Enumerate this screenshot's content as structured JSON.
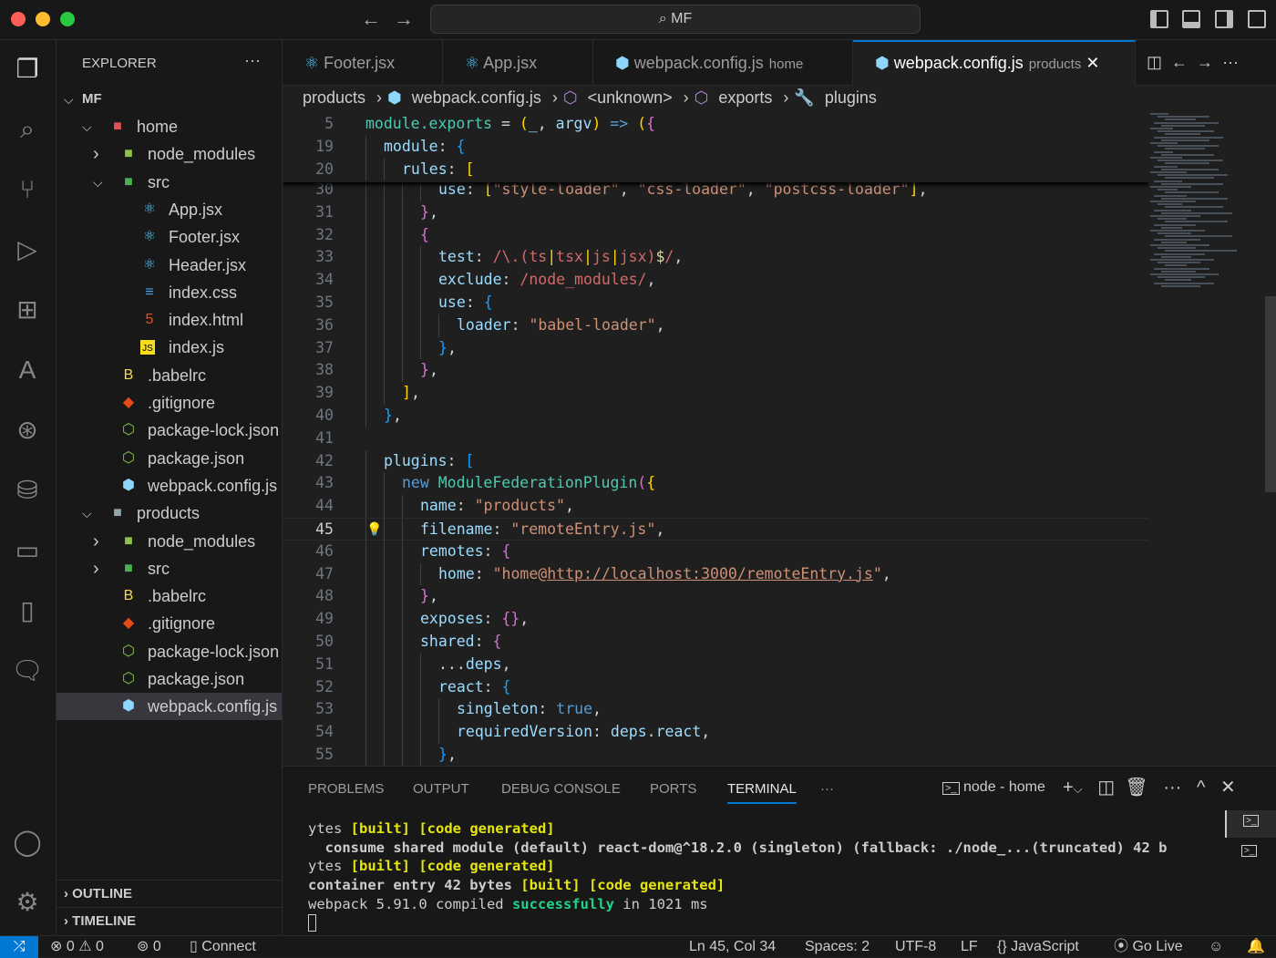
{
  "titlebar": {
    "search": "MF",
    "search_icon": "search-icon"
  },
  "explorer": {
    "title": "EXPLORER",
    "root": "MF",
    "tree": [
      {
        "label": "home",
        "depth": 1,
        "type": "folder-open",
        "icon": "home-folder-icon",
        "color": "#e05252"
      },
      {
        "label": "node_modules",
        "depth": 2,
        "type": "folder",
        "icon": "node-folder-icon",
        "color": "#8bc34a"
      },
      {
        "label": "src",
        "depth": 2,
        "type": "folder-open",
        "icon": "src-folder-icon",
        "color": "#4caf50"
      },
      {
        "label": "App.jsx",
        "depth": 3,
        "type": "file",
        "icon": "react-icon",
        "color": "#4fc3f7"
      },
      {
        "label": "Footer.jsx",
        "depth": 3,
        "type": "file",
        "icon": "react-icon",
        "color": "#4fc3f7"
      },
      {
        "label": "Header.jsx",
        "depth": 3,
        "type": "file",
        "icon": "react-icon",
        "color": "#4fc3f7"
      },
      {
        "label": "index.css",
        "depth": 3,
        "type": "file",
        "icon": "css-icon",
        "color": "#42a5f5"
      },
      {
        "label": "index.html",
        "depth": 3,
        "type": "file",
        "icon": "html-icon",
        "color": "#e44d26"
      },
      {
        "label": "index.js",
        "depth": 3,
        "type": "file",
        "icon": "js-icon",
        "color": "#f5de19"
      },
      {
        "label": ".babelrc",
        "depth": 2,
        "type": "file",
        "icon": "babel-icon",
        "color": "#f5da55"
      },
      {
        "label": ".gitignore",
        "depth": 2,
        "type": "file",
        "icon": "git-icon",
        "color": "#e64a19"
      },
      {
        "label": "package-lock.json",
        "depth": 2,
        "type": "file",
        "icon": "npm-icon",
        "color": "#8bc34a"
      },
      {
        "label": "package.json",
        "depth": 2,
        "type": "file",
        "icon": "npm-icon",
        "color": "#8bc34a"
      },
      {
        "label": "webpack.config.js",
        "depth": 2,
        "type": "file",
        "icon": "webpack-icon",
        "color": "#8ed6fb"
      },
      {
        "label": "products",
        "depth": 1,
        "type": "folder-open",
        "icon": "folder-icon",
        "color": "#90a4ae"
      },
      {
        "label": "node_modules",
        "depth": 2,
        "type": "folder",
        "icon": "node-folder-icon",
        "color": "#8bc34a"
      },
      {
        "label": "src",
        "depth": 2,
        "type": "folder",
        "icon": "src-folder-icon",
        "color": "#4caf50"
      },
      {
        "label": ".babelrc",
        "depth": 2,
        "type": "file",
        "icon": "babel-icon",
        "color": "#f5da55"
      },
      {
        "label": ".gitignore",
        "depth": 2,
        "type": "file",
        "icon": "git-icon",
        "color": "#e64a19"
      },
      {
        "label": "package-lock.json",
        "depth": 2,
        "type": "file",
        "icon": "npm-icon",
        "color": "#8bc34a"
      },
      {
        "label": "package.json",
        "depth": 2,
        "type": "file",
        "icon": "npm-icon",
        "color": "#8bc34a"
      },
      {
        "label": "webpack.config.js",
        "depth": 2,
        "type": "file",
        "icon": "webpack-icon",
        "color": "#8ed6fb",
        "selected": true
      }
    ],
    "outline": "OUTLINE",
    "timeline": "TIMELINE"
  },
  "tabs": [
    {
      "label": "Footer.jsx",
      "desc": "",
      "icon": "react-icon"
    },
    {
      "label": "App.jsx",
      "desc": "",
      "icon": "react-icon"
    },
    {
      "label": "webpack.config.js",
      "desc": "home",
      "icon": "webpack-icon"
    },
    {
      "label": "webpack.config.js",
      "desc": "products",
      "icon": "webpack-icon",
      "active": true
    }
  ],
  "breadcrumb": [
    "products",
    "webpack.config.js",
    "<unknown>",
    "exports",
    "plugins"
  ],
  "code": {
    "current_line": 45,
    "sticky": [
      {
        "n": 5,
        "i": 0,
        "tk": [
          [
            "t",
            "module.exports"
          ],
          [
            "p",
            " = "
          ],
          [
            "b1",
            "("
          ],
          [
            "v",
            "_"
          ],
          [
            "p",
            ", "
          ],
          [
            "v",
            "argv"
          ],
          [
            "b1",
            ")"
          ],
          [
            "kw",
            " => "
          ],
          [
            "b1",
            "("
          ],
          [
            "b2",
            "{"
          ]
        ]
      },
      {
        "n": 19,
        "i": 2,
        "tk": [
          [
            "k",
            "module"
          ],
          [
            "p",
            ": "
          ],
          [
            "b3",
            "{"
          ]
        ]
      },
      {
        "n": 20,
        "i": 4,
        "tk": [
          [
            "k",
            "rules"
          ],
          [
            "p",
            ": "
          ],
          [
            "b1",
            "["
          ]
        ]
      }
    ],
    "lines": [
      {
        "n": 30,
        "i": 8,
        "tk": [
          [
            "k",
            "use"
          ],
          [
            "p",
            ": "
          ],
          [
            "b1",
            "["
          ],
          [
            "s",
            "\"style-loader\""
          ],
          [
            "p",
            ", "
          ],
          [
            "s",
            "\"css-loader\""
          ],
          [
            "p",
            ", "
          ],
          [
            "s",
            "\"postcss-loader\""
          ],
          [
            "b1",
            "]"
          ],
          [
            "p",
            ","
          ]
        ]
      },
      {
        "n": 31,
        "i": 6,
        "tk": [
          [
            "b2",
            "}"
          ],
          [
            "p",
            ","
          ]
        ]
      },
      {
        "n": 32,
        "i": 6,
        "tk": [
          [
            "b2",
            "{"
          ]
        ]
      },
      {
        "n": 33,
        "i": 8,
        "tk": [
          [
            "k",
            "test"
          ],
          [
            "p",
            ": "
          ],
          [
            "r",
            "/\\.(ts"
          ],
          [
            "b1",
            "|"
          ],
          [
            "r",
            "tsx"
          ],
          [
            "b1",
            "|"
          ],
          [
            "r",
            "js"
          ],
          [
            "b1",
            "|"
          ],
          [
            "r",
            "jsx)"
          ],
          [
            "ds",
            "$"
          ],
          [
            "r",
            "/"
          ],
          [
            "p",
            ","
          ]
        ]
      },
      {
        "n": 34,
        "i": 8,
        "tk": [
          [
            "k",
            "exclude"
          ],
          [
            "p",
            ": "
          ],
          [
            "r",
            "/node_modules/"
          ],
          [
            "p",
            ","
          ]
        ]
      },
      {
        "n": 35,
        "i": 8,
        "tk": [
          [
            "k",
            "use"
          ],
          [
            "p",
            ": "
          ],
          [
            "b3",
            "{"
          ]
        ]
      },
      {
        "n": 36,
        "i": 10,
        "tk": [
          [
            "k",
            "loader"
          ],
          [
            "p",
            ": "
          ],
          [
            "s",
            "\"babel-loader\""
          ],
          [
            "p",
            ","
          ]
        ]
      },
      {
        "n": 37,
        "i": 8,
        "tk": [
          [
            "b3",
            "}"
          ],
          [
            "p",
            ","
          ]
        ]
      },
      {
        "n": 38,
        "i": 6,
        "tk": [
          [
            "b2",
            "}"
          ],
          [
            "p",
            ","
          ]
        ]
      },
      {
        "n": 39,
        "i": 4,
        "tk": [
          [
            "b1",
            "]"
          ],
          [
            "p",
            ","
          ]
        ]
      },
      {
        "n": 40,
        "i": 2,
        "tk": [
          [
            "b3",
            "}"
          ],
          [
            "p",
            ","
          ]
        ]
      },
      {
        "n": 41,
        "i": 0,
        "tk": []
      },
      {
        "n": 42,
        "i": 2,
        "tk": [
          [
            "k",
            "plugins"
          ],
          [
            "p",
            ": "
          ],
          [
            "b3",
            "["
          ]
        ]
      },
      {
        "n": 43,
        "i": 4,
        "tk": [
          [
            "kw",
            "new "
          ],
          [
            "t",
            "ModuleFederationPlugin"
          ],
          [
            "b2",
            "("
          ],
          [
            "b1",
            "{"
          ]
        ]
      },
      {
        "n": 44,
        "i": 6,
        "tk": [
          [
            "k",
            "name"
          ],
          [
            "p",
            ": "
          ],
          [
            "s",
            "\"products\""
          ],
          [
            "p",
            ","
          ]
        ]
      },
      {
        "n": 45,
        "i": 6,
        "tk": [
          [
            "k",
            "filename"
          ],
          [
            "p",
            ": "
          ],
          [
            "s",
            "\"remoteEntry.js\""
          ],
          [
            "p",
            ","
          ]
        ]
      },
      {
        "n": 46,
        "i": 6,
        "tk": [
          [
            "k",
            "remotes"
          ],
          [
            "p",
            ": "
          ],
          [
            "b2",
            "{"
          ]
        ]
      },
      {
        "n": 47,
        "i": 8,
        "tk": [
          [
            "k",
            "home"
          ],
          [
            "p",
            ": "
          ],
          [
            "s",
            "\"home@"
          ],
          [
            "s u",
            "http://localhost:3000/remoteEntry.js"
          ],
          [
            "s",
            "\""
          ],
          [
            "p",
            ","
          ]
        ]
      },
      {
        "n": 48,
        "i": 6,
        "tk": [
          [
            "b2",
            "}"
          ],
          [
            "p",
            ","
          ]
        ]
      },
      {
        "n": 49,
        "i": 6,
        "tk": [
          [
            "k",
            "exposes"
          ],
          [
            "p",
            ": "
          ],
          [
            "b2",
            "{}"
          ],
          [
            "p",
            ","
          ]
        ]
      },
      {
        "n": 50,
        "i": 6,
        "tk": [
          [
            "k",
            "shared"
          ],
          [
            "p",
            ": "
          ],
          [
            "b2",
            "{"
          ]
        ]
      },
      {
        "n": 51,
        "i": 8,
        "tk": [
          [
            "p",
            "..."
          ],
          [
            "v",
            "deps"
          ],
          [
            "p",
            ","
          ]
        ]
      },
      {
        "n": 52,
        "i": 8,
        "tk": [
          [
            "k",
            "react"
          ],
          [
            "p",
            ": "
          ],
          [
            "b3",
            "{"
          ]
        ]
      },
      {
        "n": 53,
        "i": 10,
        "tk": [
          [
            "k",
            "singleton"
          ],
          [
            "p",
            ": "
          ],
          [
            "kw",
            "true"
          ],
          [
            "p",
            ","
          ]
        ]
      },
      {
        "n": 54,
        "i": 10,
        "tk": [
          [
            "k",
            "requiredVersion"
          ],
          [
            "p",
            ": "
          ],
          [
            "v",
            "deps"
          ],
          [
            "p",
            "."
          ],
          [
            "v",
            "react"
          ],
          [
            "p",
            ","
          ]
        ]
      },
      {
        "n": 55,
        "i": 8,
        "tk": [
          [
            "b3",
            "}"
          ],
          [
            "p",
            ","
          ]
        ]
      }
    ]
  },
  "panel": {
    "tabs": [
      "PROBLEMS",
      "OUTPUT",
      "DEBUG CONSOLE",
      "PORTS",
      "TERMINAL"
    ],
    "active": "TERMINAL",
    "more": "···",
    "terminal_name": "node - home",
    "terminal": [
      [
        [
          "",
          "ytes "
        ],
        [
          "y",
          "[built] [code generated]"
        ]
      ],
      [
        [
          "bold",
          "  consume shared module (default) react-dom@^18.2.0 (singleton) (fallback: ./node_...(truncated) 42 b"
        ]
      ],
      [
        [
          "",
          "ytes "
        ],
        [
          "y",
          "[built] [code generated]"
        ]
      ],
      [
        [
          "bold",
          "container entry 42 bytes "
        ],
        [
          "y",
          "[built] [code generated]"
        ]
      ],
      [
        [
          "",
          "webpack 5.91.0 compiled "
        ],
        [
          "g",
          "successfully"
        ],
        [
          "",
          " in 1021 ms"
        ]
      ]
    ]
  },
  "statusbar": {
    "errors": "0",
    "warnings": "0",
    "ports": "0",
    "connect": "Connect",
    "position": "Ln 45, Col 34",
    "spaces": "Spaces: 2",
    "encoding": "UTF-8",
    "eol": "LF",
    "language": "JavaScript",
    "golive": "Go Live"
  },
  "colors": {
    "accent": "#0078d4",
    "remote": "#0078d4"
  }
}
